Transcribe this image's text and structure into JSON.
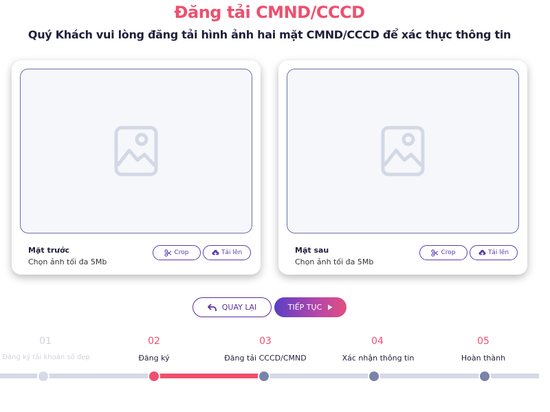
{
  "page": {
    "title": "Đăng tải CMND/CCCD",
    "subtitle": "Quý Khách vui lòng đăng tải hình ảnh hai mặt CMND/CCCD để xác thực thông tin"
  },
  "cards": [
    {
      "label": "Mặt trước",
      "hint": "Chọn ảnh tối đa 5Mb",
      "crop_label": "Crop",
      "upload_label": "Tải lên"
    },
    {
      "label": "Mặt sau",
      "hint": "Chọn ảnh tối đa 5Mb",
      "crop_label": "Crop",
      "upload_label": "Tải lên"
    }
  ],
  "nav": {
    "back_label": "QUAY LẠI",
    "next_label": "TIẾP TỤC"
  },
  "steps": [
    {
      "number": "01",
      "label": "Đăng ký tài khoản số đẹp",
      "state": "done"
    },
    {
      "number": "02",
      "label": "Đăng ký",
      "state": "done"
    },
    {
      "number": "03",
      "label": "Đăng tải CCCD/CMND",
      "state": "current"
    },
    {
      "number": "04",
      "label": "Xác nhận thông tin",
      "state": "upcoming"
    },
    {
      "number": "05",
      "label": "Hoàn thành",
      "state": "upcoming"
    }
  ],
  "colors": {
    "accent": "#ef4f6e",
    "primary": "#5b2ca8",
    "track": "#d6d9e6",
    "dot_upcoming": "#7a83a8",
    "faded": "#d0d3de"
  }
}
